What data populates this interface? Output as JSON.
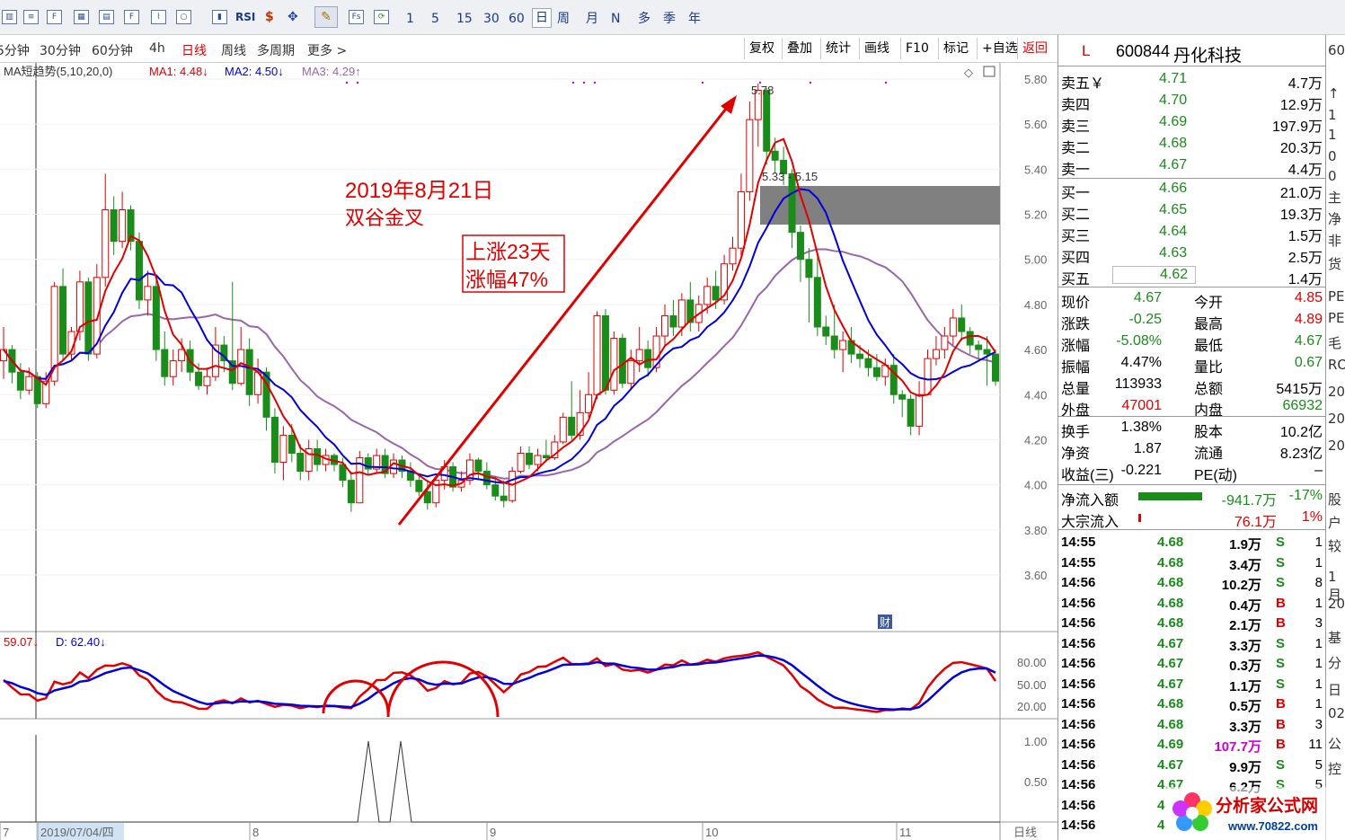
{
  "toolbar": {
    "icons": [
      "chart-icon",
      "f10-icon",
      "table-icon",
      "list-icon",
      "f12-icon",
      "kline-icon",
      "circle-icon",
      "bar-icon",
      "rsi-icon",
      "money-icon",
      "move-icon",
      "pen-icon",
      "fs-icon",
      "refresh-icon"
    ],
    "rsi_label": "RSI",
    "f9_label": "Fs",
    "periods": [
      "1",
      "5",
      "15",
      "30",
      "60",
      "日",
      "周",
      "月",
      "N",
      "多",
      "季",
      "年"
    ]
  },
  "periodbar": {
    "items": [
      "5分钟",
      "30分钟",
      "60分钟",
      "4h",
      "日线",
      "周线",
      "多周期",
      "更多 >"
    ],
    "buttons": [
      "复权",
      "叠加",
      "统计",
      "画线",
      "F10",
      "标记",
      "+自选",
      "返回"
    ]
  },
  "indicator": {
    "name": "MA短趋势(5,10,20,0)",
    "ma1": "MA1: 4.48",
    "ma2": "MA2: 4.50",
    "ma3": "MA3: 4.29",
    "kd_k": "59.07",
    "kd_d": "D: 62.40"
  },
  "annotations": {
    "date_title": "2019年8月21日",
    "date_sub": "双谷金叉",
    "gain_days": "上涨23天",
    "gain_pct": "涨幅47%",
    "high_label": "5.78",
    "range_label": "5.33 - 5.15",
    "cai": "财"
  },
  "colors": {
    "up": "#e00000",
    "down": "#1a8c1a",
    "ma1": "#e00000",
    "ma2": "#0000dd",
    "ma3": "#9966aa",
    "gray_box": "#808080"
  },
  "chart_data": {
    "type": "candlestick",
    "price_axis": [
      "5.80",
      "5.60",
      "5.40",
      "5.20",
      "5.00",
      "4.80",
      "4.60",
      "4.40",
      "4.20",
      "4.00",
      "3.80",
      "3.60"
    ],
    "kd_axis": [
      "80.00",
      "50.00",
      "20.00"
    ],
    "signal_axis": [
      "1.00",
      "0.50"
    ],
    "ylim": [
      3.5,
      5.85
    ],
    "x_labels": [
      "7",
      "2019/07/04/四",
      "8",
      "9",
      "10",
      "11"
    ],
    "period_label": "日线",
    "candles": [
      [
        4.55,
        4.6,
        4.47,
        4.7
      ],
      [
        4.6,
        4.5,
        4.45,
        4.62
      ],
      [
        4.5,
        4.42,
        4.38,
        4.54
      ],
      [
        4.42,
        4.48,
        4.4,
        4.52
      ],
      [
        4.48,
        4.36,
        4.34,
        4.5
      ],
      [
        4.36,
        4.46,
        4.34,
        4.5
      ],
      [
        4.46,
        4.88,
        4.44,
        4.9
      ],
      [
        4.88,
        4.58,
        4.55,
        4.96
      ],
      [
        4.58,
        4.68,
        4.55,
        4.7
      ],
      [
        4.68,
        4.9,
        4.64,
        4.95
      ],
      [
        4.9,
        4.58,
        4.55,
        4.92
      ],
      [
        4.58,
        4.92,
        4.56,
        4.98
      ],
      [
        4.92,
        5.22,
        4.88,
        5.38
      ],
      [
        5.22,
        5.08,
        5.02,
        5.28
      ],
      [
        5.08,
        5.22,
        5.05,
        5.3
      ],
      [
        5.22,
        5.08,
        5.04,
        5.24
      ],
      [
        5.08,
        4.82,
        4.78,
        5.12
      ],
      [
        4.82,
        4.88,
        4.75,
        4.95
      ],
      [
        4.88,
        4.6,
        4.55,
        4.92
      ],
      [
        4.6,
        4.48,
        4.44,
        4.68
      ],
      [
        4.48,
        4.55,
        4.44,
        4.6
      ],
      [
        4.55,
        4.6,
        4.5,
        4.65
      ],
      [
        4.6,
        4.5,
        4.46,
        4.64
      ],
      [
        4.5,
        4.44,
        4.42,
        4.54
      ],
      [
        4.44,
        4.48,
        4.4,
        4.52
      ],
      [
        4.48,
        4.62,
        4.46,
        4.7
      ],
      [
        4.62,
        4.55,
        4.5,
        4.66
      ],
      [
        4.55,
        4.45,
        4.42,
        4.9
      ],
      [
        4.45,
        4.6,
        4.44,
        4.7
      ],
      [
        4.6,
        4.4,
        4.35,
        4.65
      ],
      [
        4.4,
        4.5,
        4.36,
        4.56
      ],
      [
        4.5,
        4.3,
        4.24,
        4.52
      ],
      [
        4.3,
        4.1,
        4.05,
        4.34
      ],
      [
        4.1,
        4.22,
        4.02,
        4.26
      ],
      [
        4.22,
        4.14,
        4.1,
        4.27
      ],
      [
        4.14,
        4.06,
        4.02,
        4.18
      ],
      [
        4.06,
        4.16,
        4.02,
        4.2
      ],
      [
        4.16,
        4.09,
        4.06,
        4.2
      ],
      [
        4.09,
        4.13,
        4.06,
        4.16
      ],
      [
        4.13,
        4.09,
        4.06,
        4.14
      ],
      [
        4.09,
        4.02,
        3.99,
        4.12
      ],
      [
        4.02,
        3.92,
        3.88,
        4.06
      ],
      [
        3.92,
        4.12,
        3.92,
        4.15
      ],
      [
        4.12,
        4.07,
        4.04,
        4.14
      ],
      [
        4.07,
        4.13,
        4.05,
        4.16
      ],
      [
        4.13,
        4.05,
        4.03,
        4.16
      ],
      [
        4.05,
        4.11,
        4.03,
        4.14
      ],
      [
        4.11,
        4.06,
        4.03,
        4.13
      ],
      [
        4.06,
        4.02,
        3.99,
        4.1
      ],
      [
        4.02,
        3.97,
        3.95,
        4.05
      ],
      [
        3.97,
        3.92,
        3.89,
        4.02
      ],
      [
        3.92,
        4.02,
        3.9,
        4.04
      ],
      [
        4.02,
        4.08,
        3.98,
        4.11
      ],
      [
        4.08,
        3.99,
        3.97,
        4.1
      ],
      [
        3.99,
        4.02,
        3.97,
        4.06
      ],
      [
        4.02,
        4.11,
        4.0,
        4.14
      ],
      [
        4.11,
        4.06,
        4.02,
        4.12
      ],
      [
        4.06,
        4.0,
        3.98,
        4.1
      ],
      [
        4.0,
        3.95,
        3.93,
        4.04
      ],
      [
        3.95,
        3.93,
        3.9,
        4.02
      ],
      [
        3.93,
        4.06,
        3.92,
        4.08
      ],
      [
        4.06,
        4.14,
        4.05,
        4.17
      ],
      [
        4.14,
        4.09,
        4.07,
        4.17
      ],
      [
        4.09,
        4.13,
        4.06,
        4.16
      ],
      [
        4.13,
        4.12,
        4.1,
        4.2
      ],
      [
        4.12,
        4.19,
        4.11,
        4.22
      ],
      [
        4.19,
        4.3,
        4.18,
        4.32
      ],
      [
        4.3,
        4.22,
        4.2,
        4.46
      ],
      [
        4.22,
        4.32,
        4.2,
        4.42
      ],
      [
        4.32,
        4.4,
        4.3,
        4.5
      ],
      [
        4.4,
        4.75,
        4.38,
        4.77
      ],
      [
        4.75,
        4.42,
        4.4,
        4.78
      ],
      [
        4.42,
        4.65,
        4.4,
        4.68
      ],
      [
        4.65,
        4.45,
        4.43,
        4.67
      ],
      [
        4.45,
        4.55,
        4.42,
        4.6
      ],
      [
        4.55,
        4.6,
        4.5,
        4.7
      ],
      [
        4.6,
        4.52,
        4.48,
        4.64
      ],
      [
        4.52,
        4.66,
        4.5,
        4.7
      ],
      [
        4.66,
        4.75,
        4.62,
        4.8
      ],
      [
        4.75,
        4.7,
        4.66,
        4.82
      ],
      [
        4.7,
        4.82,
        4.66,
        4.85
      ],
      [
        4.82,
        4.72,
        4.68,
        4.9
      ],
      [
        4.72,
        4.8,
        4.68,
        4.84
      ],
      [
        4.8,
        4.88,
        4.76,
        4.92
      ],
      [
        4.88,
        4.82,
        4.78,
        4.95
      ],
      [
        4.82,
        4.98,
        4.8,
        5.02
      ],
      [
        4.98,
        5.05,
        4.95,
        5.1
      ],
      [
        5.05,
        5.3,
        5.0,
        5.38
      ],
      [
        5.3,
        5.62,
        5.26,
        5.7
      ],
      [
        5.62,
        5.75,
        5.5,
        5.78
      ],
      [
        5.75,
        5.48,
        5.42,
        5.76
      ],
      [
        5.48,
        5.44,
        5.38,
        5.54
      ],
      [
        5.44,
        5.38,
        5.33,
        5.5
      ],
      [
        5.38,
        5.12,
        5.05,
        5.4
      ],
      [
        5.12,
        5.0,
        4.9,
        5.15
      ],
      [
        5.0,
        4.92,
        4.72,
        5.05
      ],
      [
        4.92,
        4.7,
        4.66,
        5.02
      ],
      [
        4.7,
        4.66,
        4.62,
        4.75
      ],
      [
        4.66,
        4.6,
        4.56,
        4.8
      ],
      [
        4.6,
        4.64,
        4.5,
        4.68
      ],
      [
        4.64,
        4.58,
        4.54,
        4.7
      ],
      [
        4.58,
        4.56,
        4.52,
        4.62
      ],
      [
        4.56,
        4.52,
        4.48,
        4.6
      ],
      [
        4.52,
        4.48,
        4.46,
        4.58
      ],
      [
        4.48,
        4.53,
        4.44,
        4.56
      ],
      [
        4.53,
        4.4,
        4.36,
        4.58
      ],
      [
        4.4,
        4.38,
        4.3,
        4.42
      ],
      [
        4.38,
        4.26,
        4.22,
        4.4
      ],
      [
        4.26,
        4.4,
        4.22,
        4.46
      ],
      [
        4.4,
        4.56,
        4.4,
        4.6
      ],
      [
        4.56,
        4.6,
        4.53,
        4.66
      ],
      [
        4.6,
        4.66,
        4.56,
        4.7
      ],
      [
        4.66,
        4.74,
        4.62,
        4.78
      ],
      [
        4.74,
        4.68,
        4.64,
        4.8
      ],
      [
        4.68,
        4.62,
        4.58,
        4.7
      ],
      [
        4.62,
        4.6,
        4.56,
        4.64
      ],
      [
        4.6,
        4.58,
        4.44,
        4.66
      ],
      [
        4.58,
        4.46,
        4.44,
        4.6
      ]
    ]
  },
  "panel": {
    "code_mark": "L",
    "code": "600844",
    "name": "丹化科技",
    "asks": [
      {
        "label": "卖五￥",
        "price": "4.71",
        "vol": "4.7万"
      },
      {
        "label": "卖四",
        "price": "4.70",
        "vol": "12.9万"
      },
      {
        "label": "卖三",
        "price": "4.69",
        "vol": "197.9万"
      },
      {
        "label": "卖二",
        "price": "4.68",
        "vol": "20.3万"
      },
      {
        "label": "卖一",
        "price": "4.67",
        "vol": "4.4万"
      }
    ],
    "bids": [
      {
        "label": "买一",
        "price": "4.66",
        "vol": "21.0万"
      },
      {
        "label": "买二",
        "price": "4.65",
        "vol": "19.3万"
      },
      {
        "label": "买三",
        "price": "4.64",
        "vol": "1.5万"
      },
      {
        "label": "买四",
        "price": "4.63",
        "vol": "2.5万"
      },
      {
        "label": "买五",
        "price": "4.62",
        "vol": "1.4万"
      }
    ],
    "stats": [
      {
        "l1": "现价",
        "v1": "4.67",
        "l2": "今开",
        "v2": "4.85",
        "c1": "g",
        "c2": "r"
      },
      {
        "l1": "涨跌",
        "v1": "-0.25",
        "l2": "最高",
        "v2": "4.89",
        "c1": "g",
        "c2": "r"
      },
      {
        "l1": "涨幅",
        "v1": "-5.08%",
        "l2": "最低",
        "v2": "4.67",
        "c1": "g",
        "c2": "g"
      },
      {
        "l1": "振幅",
        "v1": "4.47%",
        "l2": "量比",
        "v2": "0.67",
        "c1": "k",
        "c2": "g"
      },
      {
        "l1": "总量",
        "v1": "113933",
        "l2": "总额",
        "v2": "5415万",
        "c1": "k",
        "c2": "k"
      },
      {
        "l1": "外盘",
        "v1": "47001",
        "l2": "内盘",
        "v2": "66932",
        "c1": "r",
        "c2": "g"
      }
    ],
    "stats2": [
      {
        "l1": "换手",
        "v1": "1.38%",
        "l2": "股本",
        "v2": "10.2亿"
      },
      {
        "l1": "净资",
        "v1": "1.87",
        "l2": "流通",
        "v2": "8.23亿"
      },
      {
        "l1": "收益(三)",
        "v1": "-0.221",
        "l2": "PE(动)",
        "v2": "–"
      }
    ],
    "flow": [
      {
        "label": "净流入额",
        "value": "-941.7万",
        "pct": "-17%",
        "color": "g"
      },
      {
        "label": "大宗流入",
        "value": "76.1万",
        "pct": "1%",
        "color": "r"
      }
    ],
    "ticks": [
      {
        "t": "14:55",
        "p": "4.68",
        "v": "1.9万",
        "s": "S",
        "n": "1",
        "pc": "g",
        "vc": "k",
        "sc": "g"
      },
      {
        "t": "14:55",
        "p": "4.68",
        "v": "3.4万",
        "s": "S",
        "n": "1",
        "pc": "g",
        "vc": "k",
        "sc": "g"
      },
      {
        "t": "14:56",
        "p": "4.68",
        "v": "10.2万",
        "s": "S",
        "n": "8",
        "pc": "g",
        "vc": "k",
        "sc": "g"
      },
      {
        "t": "14:56",
        "p": "4.68",
        "v": "0.4万",
        "s": "B",
        "n": "1",
        "pc": "g",
        "vc": "k",
        "sc": "r"
      },
      {
        "t": "14:56",
        "p": "4.68",
        "v": "2.1万",
        "s": "B",
        "n": "3",
        "pc": "g",
        "vc": "k",
        "sc": "r"
      },
      {
        "t": "14:56",
        "p": "4.67",
        "v": "3.3万",
        "s": "S",
        "n": "1",
        "pc": "g",
        "vc": "k",
        "sc": "g"
      },
      {
        "t": "14:56",
        "p": "4.67",
        "v": "0.3万",
        "s": "S",
        "n": "1",
        "pc": "g",
        "vc": "k",
        "sc": "g"
      },
      {
        "t": "14:56",
        "p": "4.67",
        "v": "1.1万",
        "s": "S",
        "n": "1",
        "pc": "g",
        "vc": "k",
        "sc": "g"
      },
      {
        "t": "14:56",
        "p": "4.68",
        "v": "0.5万",
        "s": "B",
        "n": "1",
        "pc": "g",
        "vc": "k",
        "sc": "r"
      },
      {
        "t": "14:56",
        "p": "4.68",
        "v": "3.3万",
        "s": "B",
        "n": "3",
        "pc": "g",
        "vc": "k",
        "sc": "r"
      },
      {
        "t": "14:56",
        "p": "4.69",
        "v": "107.7万",
        "s": "B",
        "n": "11",
        "pc": "g",
        "vc": "m",
        "sc": "r"
      },
      {
        "t": "14:56",
        "p": "4.67",
        "v": "9.9万",
        "s": "S",
        "n": "5",
        "pc": "g",
        "vc": "k",
        "sc": "g"
      },
      {
        "t": "14:56",
        "p": "4.67",
        "v": "6.2万",
        "s": "S",
        "n": "5",
        "pc": "g",
        "vc": "k",
        "sc": "g"
      },
      {
        "t": "14:56",
        "p": "4",
        "v": "",
        "s": "",
        "n": "",
        "pc": "g",
        "vc": "k",
        "sc": "g"
      },
      {
        "t": "14:56",
        "p": "4",
        "v": "",
        "s": "",
        "n": "",
        "pc": "g",
        "vc": "k",
        "sc": "g"
      }
    ]
  },
  "edge": [
    "60",
    "↑",
    "1",
    "1",
    "0",
    "0",
    "主",
    "净",
    "非",
    "货",
    "PE",
    "PE",
    "毛",
    "RO",
    "20",
    "20",
    "20",
    "股",
    "户",
    "较",
    "1月",
    "20",
    "基",
    "分",
    "日",
    "02",
    "公",
    "控"
  ],
  "logo": {
    "text": "分析家公式网",
    "url": "www.70822.com"
  }
}
